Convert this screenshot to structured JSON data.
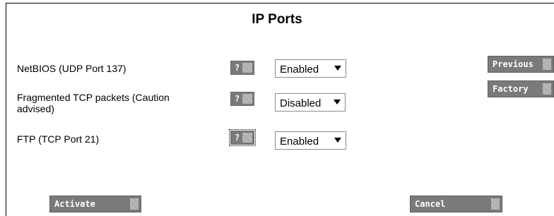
{
  "page": {
    "title": "IP Ports"
  },
  "settings": [
    {
      "label": "NetBIOS (UDP Port 137)",
      "help": "?",
      "value": "Enabled"
    },
    {
      "label": "Fragmented TCP packets (Caution advised)",
      "help": "?",
      "value": "Disabled"
    },
    {
      "label": "FTP (TCP Port 21)",
      "help": "?",
      "value": "Enabled"
    }
  ],
  "side_buttons": {
    "previous": "Previous",
    "factory": "Factory"
  },
  "footer": {
    "activate": "Activate",
    "cancel": "Cancel"
  },
  "colors": {
    "button_bg": "#7a7a7a",
    "button_text": "#ffffff"
  }
}
